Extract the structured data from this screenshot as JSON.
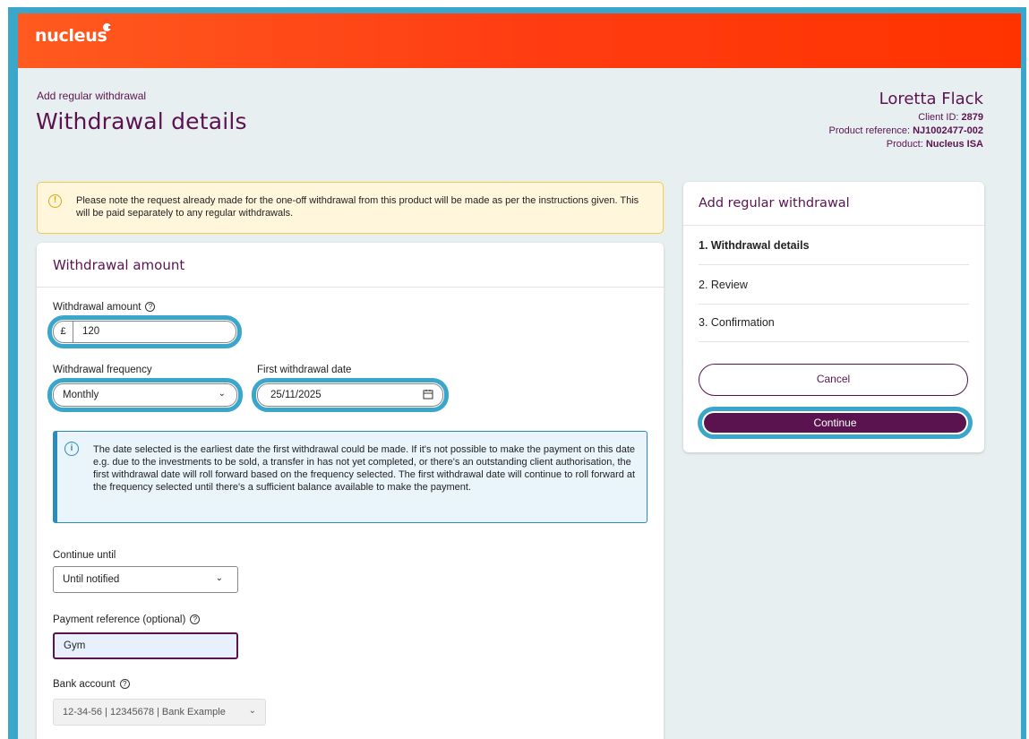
{
  "brand": {
    "logo_text": "nucleus",
    "header_gradient": [
      "#ff5a1f",
      "#ff3300"
    ],
    "accent": "#5b1350",
    "highlight": "#3aa6cc"
  },
  "page": {
    "breadcrumb": "Add regular withdrawal",
    "title": "Withdrawal details"
  },
  "client": {
    "name": "Loretta Flack",
    "id_label": "Client ID: ",
    "id_value": "2879",
    "ref_label": "Product reference: ",
    "ref_value": "NJ1002477-002",
    "product_label": "Product: ",
    "product_value": "Nucleus ISA"
  },
  "notice": {
    "icon": "warning-circle-icon",
    "text": "Please note the request already made for the one-off withdrawal from this product will be made as per the instructions given. This will be paid separately to any regular withdrawals."
  },
  "form": {
    "section_title": "Withdrawal amount",
    "amount_label": "Withdrawal amount",
    "currency": "£",
    "amount_value": "120",
    "frequency_label": "Withdrawal frequency",
    "frequency_value": "Monthly",
    "first_date_label": "First withdrawal date",
    "first_date_value": "25/11/2025",
    "info_text": "The date selected is the earliest date the first withdrawal could be made. If it's not possible to make the payment on this date e.g. due to the investments to be sold, a transfer in has not yet completed, or there's an outstanding client authorisation, the first withdrawal date will roll forward based on the frequency selected. The first withdrawal date will continue to roll forward at the frequency selected until there's a sufficient balance available to make the payment.",
    "continue_until_label": "Continue until",
    "continue_until_value": "Until notified",
    "payment_ref_label": "Payment reference (optional)",
    "payment_ref_value": "Gym",
    "bank_label": "Bank account",
    "bank_value": "12-34-56 | 12345678 | Bank Example"
  },
  "sidebar": {
    "title": "Add regular withdrawal",
    "steps": [
      "1. Withdrawal details",
      "2. Review",
      "3. Confirmation"
    ],
    "cancel_label": "Cancel",
    "continue_label": "Continue"
  }
}
